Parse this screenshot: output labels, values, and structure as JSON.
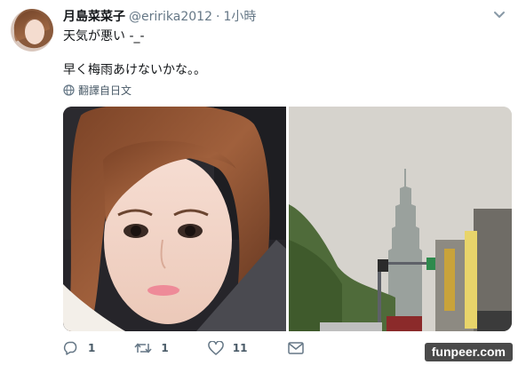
{
  "tweet": {
    "display_name": "月島菜菜子",
    "handle": "@eririka2012",
    "separator": "·",
    "timestamp": "1小時",
    "text_line1": "天気が悪い -_-",
    "text_line2": "早く梅雨あけないかな。。",
    "translate_label": "翻譯自日文",
    "avatar_icon": "profile-photo",
    "caret_icon": "chevron-down-icon"
  },
  "media": {
    "photo_left": "selfie-in-car",
    "photo_right": "city-skyline-taipei-101"
  },
  "actions": {
    "reply_count": "1",
    "retweet_count": "1",
    "like_count": "11",
    "reply_icon": "reply-icon",
    "retweet_icon": "retweet-icon",
    "like_icon": "heart-icon",
    "dm_icon": "mail-icon"
  },
  "watermark": {
    "text": "funpeer.com"
  },
  "colors": {
    "text_primary": "#14171a",
    "text_secondary": "#657786",
    "background": "#ffffff"
  }
}
